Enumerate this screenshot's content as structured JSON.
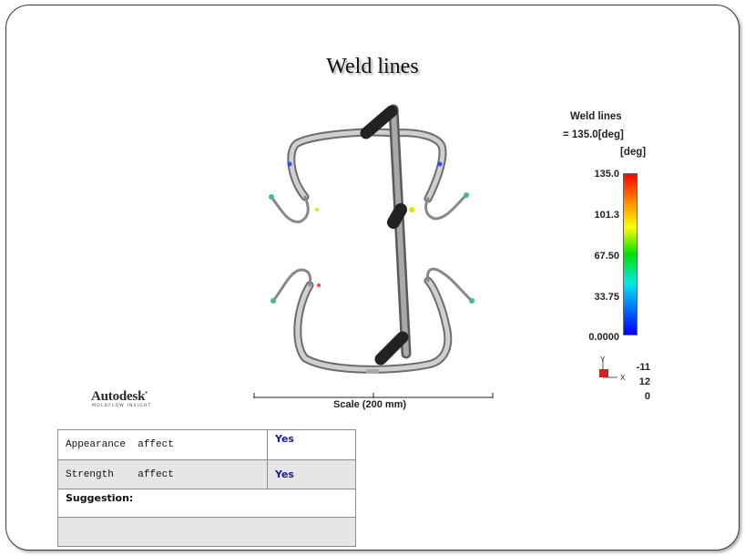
{
  "slide": {
    "title": "Weld lines"
  },
  "legend": {
    "title": "Weld lines",
    "equation": "= 135.0[deg]",
    "unit": "[deg]",
    "ticks": [
      "135.0",
      "101.3",
      "67.50",
      "33.75",
      "0.0000"
    ],
    "colors": {
      "max": "#ff0000",
      "mid": "#00e000",
      "min": "#0000ff"
    }
  },
  "orientation": {
    "y_label": "Y",
    "x_label": "X",
    "values": [
      "-11",
      "12",
      "0"
    ]
  },
  "logo": {
    "name": "Autodesk",
    "tagline": "MOLDFLOW INSIGHT"
  },
  "scale": {
    "label": "Scale (200 mm)"
  },
  "table": {
    "rows": [
      {
        "label": "Appearance  affect",
        "value": "Yes"
      },
      {
        "label": "Strength    affect",
        "value": "Yes"
      }
    ],
    "suggestion_label": "Suggestion:",
    "suggestion_value": ""
  }
}
